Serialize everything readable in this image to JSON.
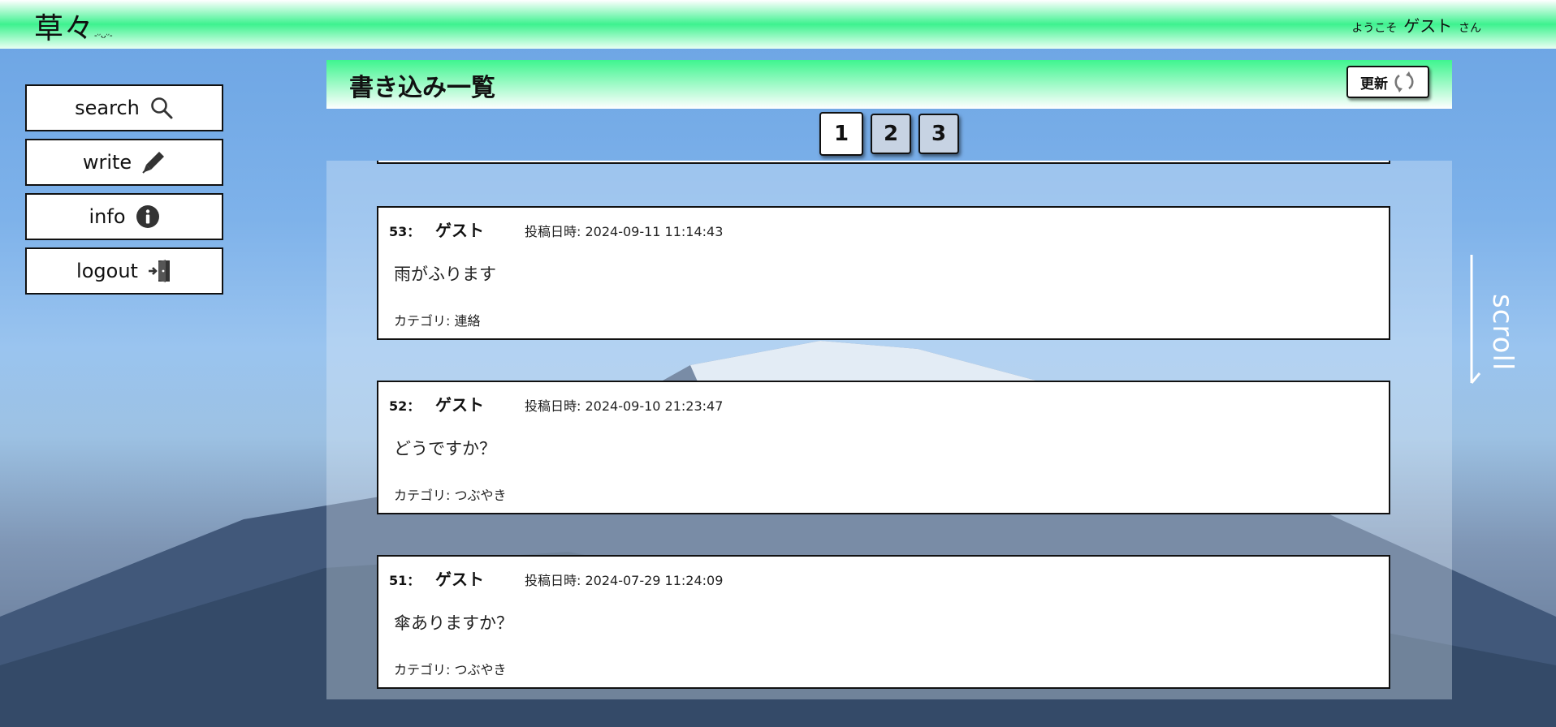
{
  "header": {
    "logo_main": "草々",
    "logo_sub": "-ᵕᴗᵕ-",
    "welcome_prefix": "ようこそ",
    "user_name": "ゲスト",
    "welcome_suffix": "さん"
  },
  "sidebar": {
    "items": [
      {
        "label": "search",
        "icon": "search-icon"
      },
      {
        "label": "write",
        "icon": "pen-icon"
      },
      {
        "label": "info",
        "icon": "info-icon"
      },
      {
        "label": "logout",
        "icon": "logout-icon"
      }
    ]
  },
  "panel": {
    "title": "書き込み一覧",
    "refresh_label": "更新"
  },
  "pagination": {
    "pages": [
      "1",
      "2",
      "3"
    ],
    "current": "1"
  },
  "posts": [
    {
      "number": "53：",
      "name": "ゲスト",
      "date": "投稿日時: 2024-09-11 11:14:43",
      "body": "雨がふります",
      "category": "カテゴリ: 連絡"
    },
    {
      "number": "52：",
      "name": "ゲスト",
      "date": "投稿日時: 2024-09-10 21:23:47",
      "body": "どうですか？",
      "category": "カテゴリ: つぶやき"
    },
    {
      "number": "51：",
      "name": "ゲスト",
      "date": "投稿日時: 2024-07-29 11:24:09",
      "body": "傘ありますか？",
      "category": "カテゴリ: つぶやき"
    }
  ],
  "scroll_hint": "scroll",
  "colors": {
    "header_green": "#3df28f",
    "sky_blue": "#6aa3e3",
    "page_inactive": "#c7d3e3"
  }
}
